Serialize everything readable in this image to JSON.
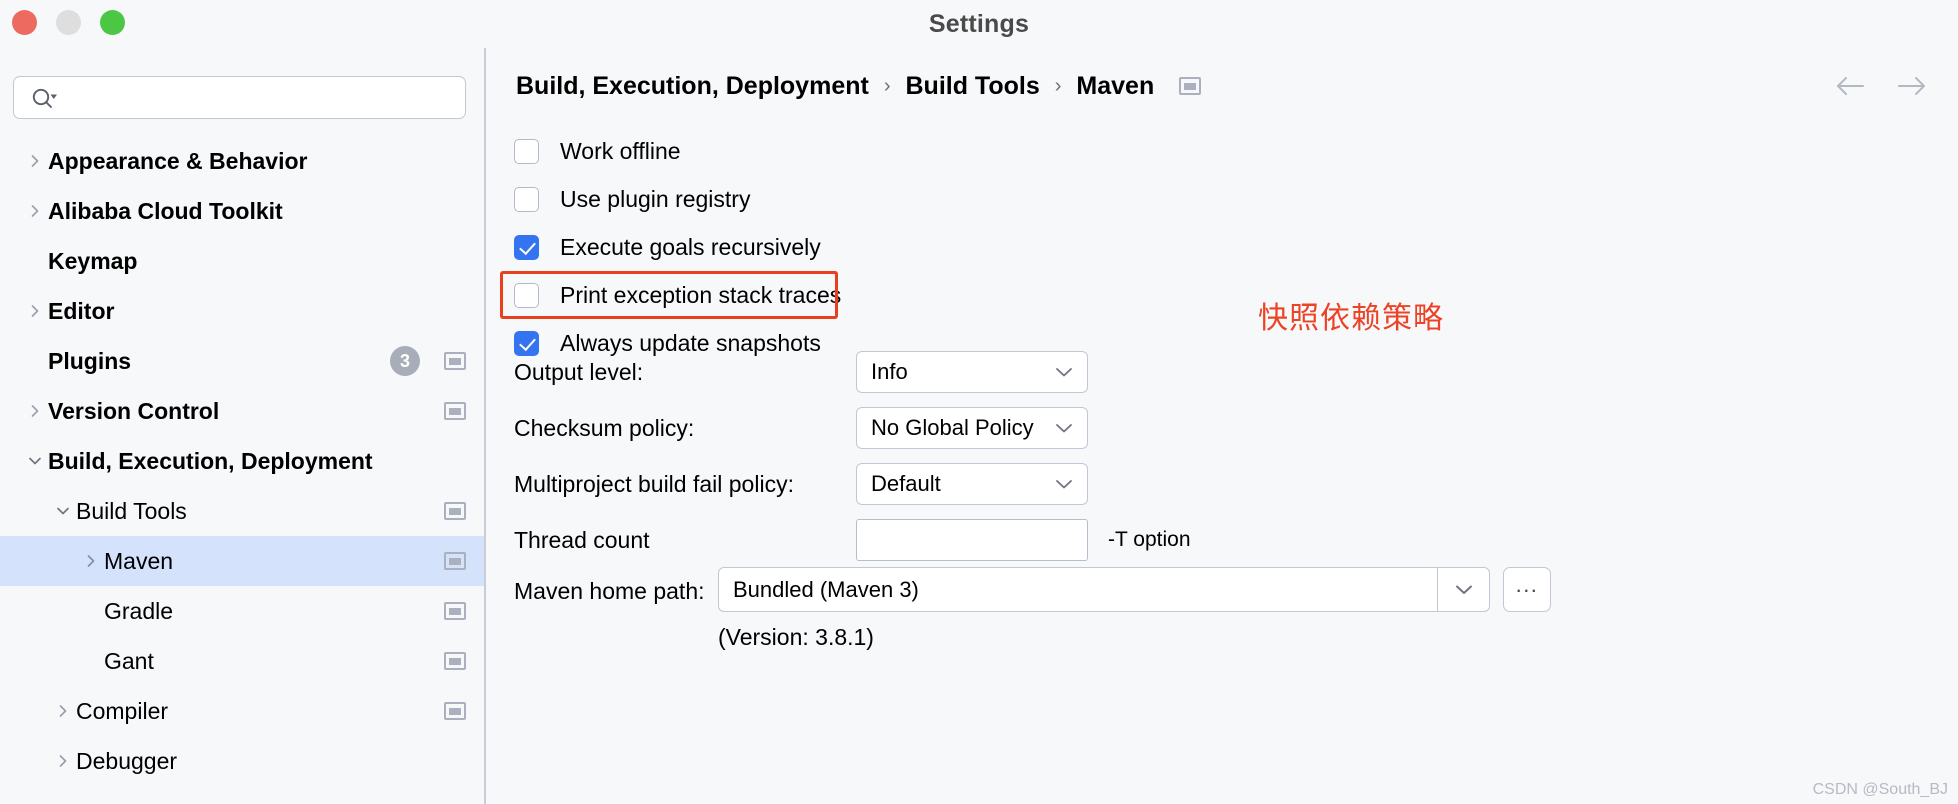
{
  "window": {
    "title": "Settings",
    "traffic_lights": [
      "close-red",
      "minimize-yellow",
      "zoom-green"
    ]
  },
  "sidebar": {
    "search": {
      "value": "",
      "placeholder": ""
    },
    "items": [
      {
        "label": "Appearance & Behavior",
        "level": 0,
        "twisty": "right",
        "bold": true,
        "badge": null,
        "screen_icon": false
      },
      {
        "label": "Alibaba Cloud Toolkit",
        "level": 0,
        "twisty": "right",
        "bold": true,
        "badge": null,
        "screen_icon": false
      },
      {
        "label": "Keymap",
        "level": 0,
        "twisty": "none",
        "bold": true,
        "badge": null,
        "screen_icon": false
      },
      {
        "label": "Editor",
        "level": 0,
        "twisty": "right",
        "bold": true,
        "badge": null,
        "screen_icon": false
      },
      {
        "label": "Plugins",
        "level": 0,
        "twisty": "none",
        "bold": true,
        "badge": "3",
        "screen_icon": true
      },
      {
        "label": "Version Control",
        "level": 0,
        "twisty": "right",
        "bold": true,
        "badge": null,
        "screen_icon": true
      },
      {
        "label": "Build, Execution, Deployment",
        "level": 0,
        "twisty": "down",
        "bold": true,
        "badge": null,
        "screen_icon": false
      },
      {
        "label": "Build Tools",
        "level": 1,
        "twisty": "down",
        "bold": false,
        "badge": null,
        "screen_icon": true
      },
      {
        "label": "Maven",
        "level": 2,
        "twisty": "right",
        "bold": false,
        "badge": null,
        "screen_icon": true,
        "selected": true
      },
      {
        "label": "Gradle",
        "level": 2,
        "twisty": "none",
        "bold": false,
        "badge": null,
        "screen_icon": true
      },
      {
        "label": "Gant",
        "level": 2,
        "twisty": "none",
        "bold": false,
        "badge": null,
        "screen_icon": true
      },
      {
        "label": "Compiler",
        "level": 1,
        "twisty": "right",
        "bold": false,
        "badge": null,
        "screen_icon": true
      },
      {
        "label": "Debugger",
        "level": 1,
        "twisty": "right",
        "bold": false,
        "badge": null,
        "screen_icon": false
      }
    ]
  },
  "main": {
    "breadcrumb": [
      "Build, Execution, Deployment",
      "Build Tools",
      "Maven"
    ],
    "breadcrumb_separator": "›",
    "nav": {
      "back": "back-arrow",
      "forward": "forward-arrow"
    },
    "checkboxes": [
      {
        "label": "Work offline",
        "checked": false
      },
      {
        "label": "Use plugin registry",
        "checked": false
      },
      {
        "label": "Execute goals recursively",
        "checked": true
      },
      {
        "label": "Print exception stack traces",
        "checked": false
      },
      {
        "label": "Always update snapshots",
        "checked": true
      }
    ],
    "annotation": {
      "text": "快照依赖策略",
      "color": "#ec4326"
    },
    "highlight_color": "#e8401f",
    "fields": [
      {
        "label": "Output level:",
        "type": "combo",
        "value": "Info",
        "suffix": ""
      },
      {
        "label": "Checksum policy:",
        "type": "combo",
        "value": "No Global Policy",
        "suffix": ""
      },
      {
        "label": "Multiproject build fail policy:",
        "type": "combo",
        "value": "Default",
        "suffix": ""
      },
      {
        "label": "Thread count",
        "type": "textfield",
        "value": "",
        "suffix": "-T option"
      }
    ],
    "maven_home": {
      "label": "Maven home path:",
      "value": "Bundled (Maven 3)",
      "browse_label": "...",
      "version_note": "(Version: 3.8.1)"
    }
  },
  "watermark": "CSDN @South_BJ",
  "colors": {
    "accent_blue": "#3574f0",
    "selection_blue": "#d4e2fc",
    "annotation_red": "#e8401f",
    "panel_bg": "#f7f8fa",
    "border": "#c3c7d4"
  }
}
